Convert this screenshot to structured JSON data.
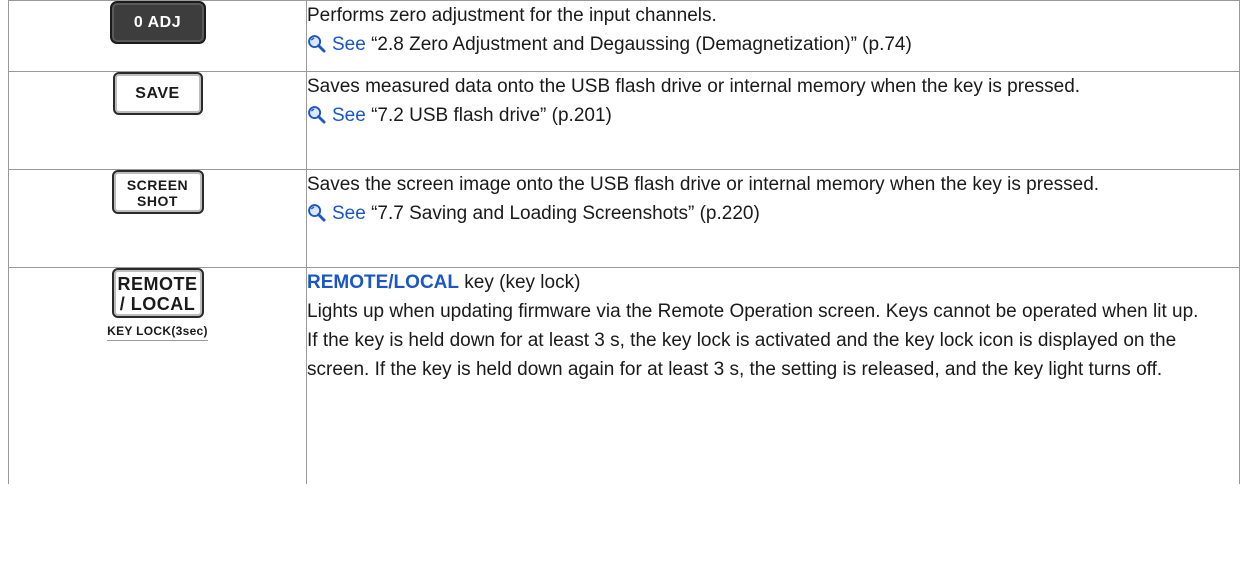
{
  "rows": [
    {
      "key": {
        "label": "0 ADJ",
        "style": "dark"
      },
      "description": "Performs zero adjustment for the input channels.",
      "reference": {
        "see": "See",
        "text": "“2.8 Zero Adjustment and Degaussing (Demagnetization)” (p.74)"
      }
    },
    {
      "key": {
        "label": "SAVE",
        "style": "light"
      },
      "description": "Saves measured data onto the USB flash drive or internal memory when the key is pressed.",
      "reference": {
        "see": "See",
        "text": "“7.2 USB flash drive” (p.201)"
      }
    },
    {
      "key": {
        "line1": "SCREEN",
        "line2": "SHOT",
        "style": "light"
      },
      "description": "Saves the screen image onto the USB flash drive or internal memory when the key is pressed.",
      "reference": {
        "see": "See",
        "text": "“7.7 Saving and Loading Screenshots” (p.220)"
      }
    },
    {
      "key": {
        "line1": "REMOTE",
        "line2": "/ LOCAL",
        "sublabel": "KEY LOCK(3sec)",
        "style": "light"
      },
      "title_strong": "REMOTE/LOCAL",
      "title_rest": " key (key lock)",
      "para1": "Lights up when updating firmware via the Remote Operation screen. Keys cannot be operated when lit up.",
      "para2": "If the key is held down for at least 3 s, the key lock is activated and the key lock icon is displayed on the screen. If the key is held down again for at least 3 s, the setting is released, and the key light turns off."
    }
  ],
  "colors": {
    "link": "#1a56c5",
    "dark_key": "#3d3d3d",
    "border": "#9a9a9a"
  },
  "icons": {
    "reference": "magnifier-icon"
  }
}
